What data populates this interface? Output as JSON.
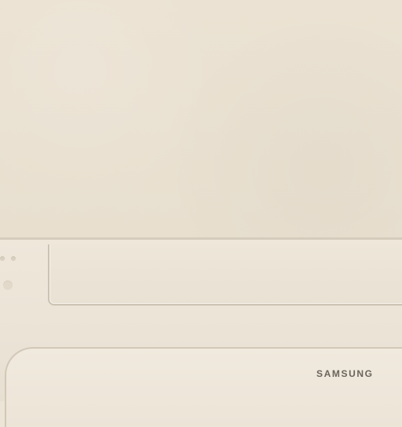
{
  "brand": {
    "logo_text": "SAMSUNG"
  },
  "colors": {
    "wall": "#ebe2d3",
    "unit_body": "#ece4d6",
    "panel_edge": "#cbc2b3",
    "logo": "#6a645c"
  },
  "icons": {
    "indicator_lights": [
      "indicator-light-icon",
      "indicator-light-icon"
    ],
    "sensor": "sensor-icon"
  }
}
